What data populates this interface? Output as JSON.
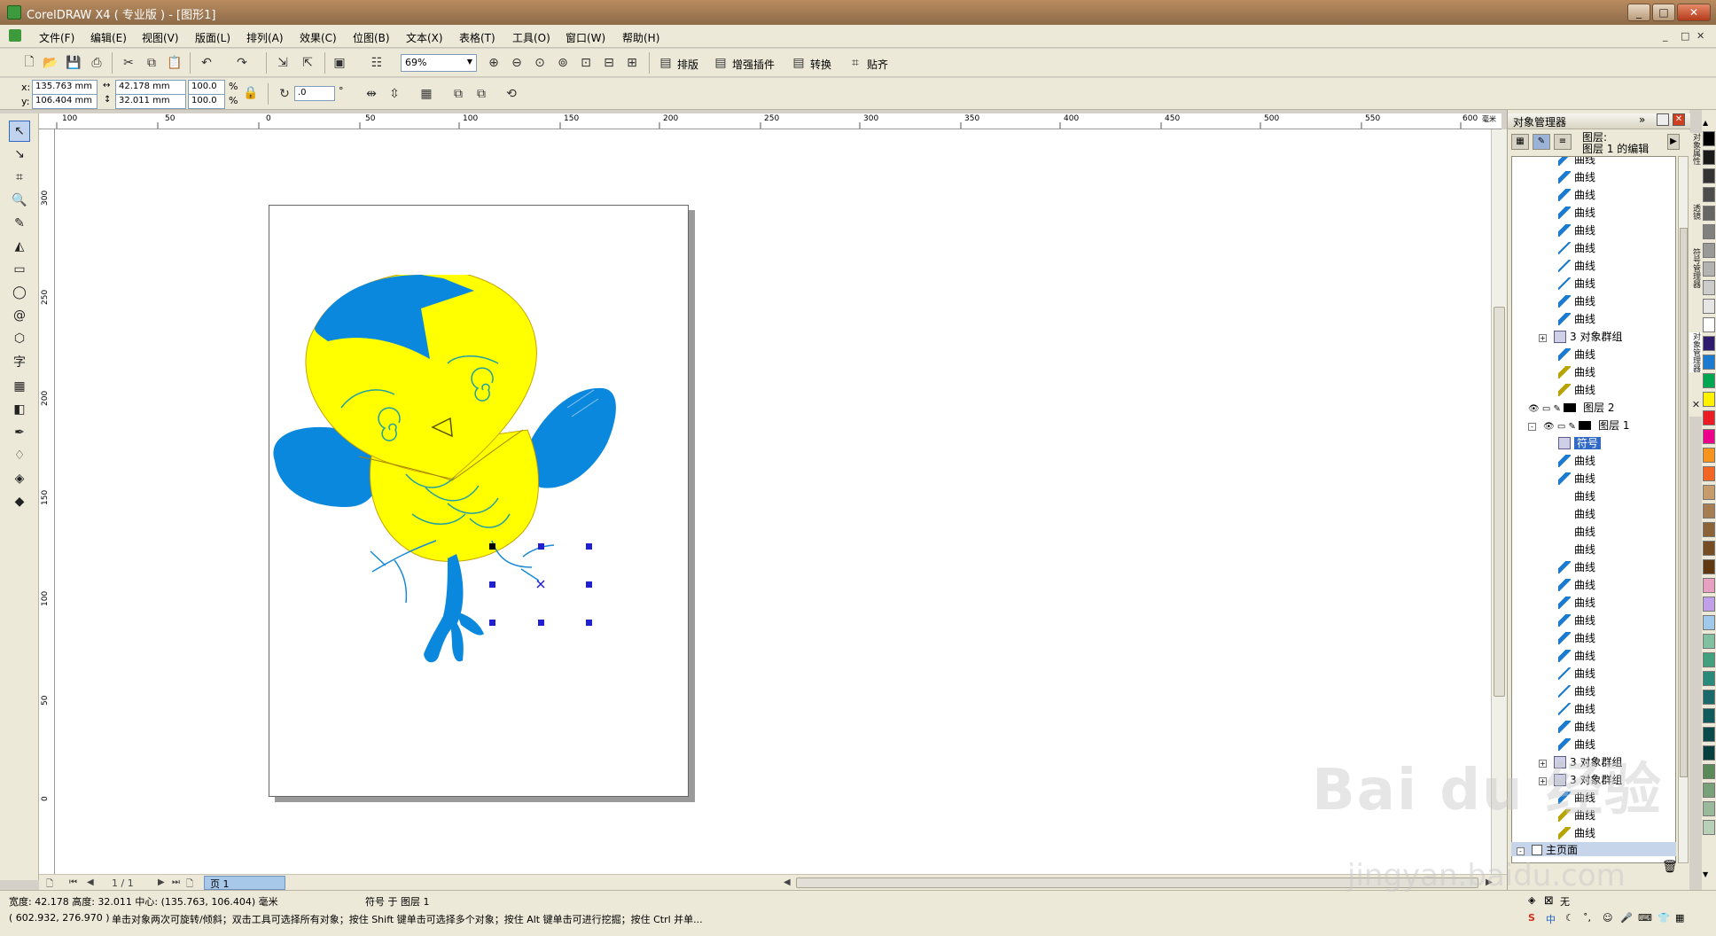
{
  "window": {
    "title": "CorelDRAW X4 ( 专业版 ) - [图形1]",
    "min": "_",
    "max": "□",
    "close": "✕"
  },
  "menu": {
    "items": [
      "文件(F)",
      "编辑(E)",
      "视图(V)",
      "版面(L)",
      "排列(A)",
      "效果(C)",
      "位图(B)",
      "文本(X)",
      "表格(T)",
      "工具(O)",
      "窗口(W)",
      "帮助(H)"
    ],
    "mdi": [
      "_",
      "□",
      "✕"
    ]
  },
  "toolbar": {
    "zoom": "69%",
    "buttons": [
      "排版",
      "增强插件",
      "转换",
      "贴齐"
    ]
  },
  "property_bar": {
    "x_label": "x:",
    "x": "135.763 mm",
    "y_label": "y:",
    "y": "106.404 mm",
    "width": "42.178 mm",
    "height": "32.011 mm",
    "scale_x": "100.0",
    "scale_y": "100.0",
    "percent": "%",
    "rotation": ".0",
    "degree": "°"
  },
  "rulers": {
    "h_ticks": [
      "100",
      "50",
      "0",
      "50",
      "100",
      "150",
      "200",
      "250",
      "300",
      "350",
      "400",
      "450",
      "500",
      "550",
      "600"
    ],
    "h_unit": "毫米",
    "v_ticks": [
      "300",
      "250",
      "200",
      "150",
      "100",
      "50",
      "0"
    ]
  },
  "toolbox": {
    "icons": [
      "pick-tool-icon",
      "shape-tool-icon",
      "crop-tool-icon",
      "zoom-tool-icon",
      "freehand-tool-icon",
      "smart-fill-icon",
      "rectangle-tool-icon",
      "ellipse-tool-icon",
      "spiral-tool-icon",
      "basic-shapes-icon",
      "text-tool-icon",
      "table-tool-icon",
      "interactive-blend-icon",
      "eyedropper-icon",
      "outline-tool-icon",
      "fill-tool-icon",
      "interactive-fill-icon"
    ],
    "text_tool_glyph": "字"
  },
  "page_nav": {
    "counter": "1 / 1",
    "tab": "页 1"
  },
  "docker": {
    "title": "对象管理器",
    "layer_header_line1": "图层:",
    "layer_header_line2": "图层 1",
    "layer_header_suffix": "的编辑",
    "rows": [
      {
        "label": "曲线",
        "icon": "curve-blue",
        "indent": 2
      },
      {
        "label": "曲线",
        "icon": "curve-blue",
        "indent": 2
      },
      {
        "label": "曲线",
        "icon": "curve-blue",
        "indent": 2
      },
      {
        "label": "曲线",
        "icon": "curve-blue",
        "indent": 2
      },
      {
        "label": "曲线",
        "icon": "curve-blue",
        "indent": 2
      },
      {
        "label": "曲线",
        "icon": "curve-thin",
        "indent": 2
      },
      {
        "label": "曲线",
        "icon": "curve-thin",
        "indent": 2
      },
      {
        "label": "曲线",
        "icon": "curve-thin",
        "indent": 2
      },
      {
        "label": "曲线",
        "icon": "curve-blue",
        "indent": 2
      },
      {
        "label": "曲线",
        "icon": "curve-blue",
        "indent": 2
      },
      {
        "label": "3 对象群组",
        "icon": "group",
        "indent": 1,
        "expand": "+"
      },
      {
        "label": "曲线",
        "icon": "curve-blue",
        "indent": 2
      },
      {
        "label": "曲线",
        "icon": "curve-gold",
        "indent": 2
      },
      {
        "label": "曲线",
        "icon": "curve-gold",
        "indent": 2
      },
      {
        "label": "图层 2",
        "icon": "layer",
        "indent": 0
      },
      {
        "label": "图层 1",
        "icon": "layer",
        "indent": 0,
        "expand": "-"
      },
      {
        "label": "符号",
        "icon": "symbol",
        "indent": 2,
        "selected": true
      },
      {
        "label": "曲线",
        "icon": "curve-blue",
        "indent": 2
      },
      {
        "label": "曲线",
        "icon": "curve-blue",
        "indent": 2
      },
      {
        "label": "曲线",
        "icon": "curve-none",
        "indent": 2
      },
      {
        "label": "曲线",
        "icon": "curve-none",
        "indent": 2
      },
      {
        "label": "曲线",
        "icon": "curve-none",
        "indent": 2
      },
      {
        "label": "曲线",
        "icon": "curve-none",
        "indent": 2
      },
      {
        "label": "曲线",
        "icon": "curve-blue",
        "indent": 2
      },
      {
        "label": "曲线",
        "icon": "curve-blue",
        "indent": 2
      },
      {
        "label": "曲线",
        "icon": "curve-blue",
        "indent": 2
      },
      {
        "label": "曲线",
        "icon": "curve-blue",
        "indent": 2
      },
      {
        "label": "曲线",
        "icon": "curve-blue",
        "indent": 2
      },
      {
        "label": "曲线",
        "icon": "curve-blue",
        "indent": 2
      },
      {
        "label": "曲线",
        "icon": "curve-thin",
        "indent": 2
      },
      {
        "label": "曲线",
        "icon": "curve-thin",
        "indent": 2
      },
      {
        "label": "曲线",
        "icon": "curve-thin",
        "indent": 2
      },
      {
        "label": "曲线",
        "icon": "curve-blue",
        "indent": 2
      },
      {
        "label": "曲线",
        "icon": "curve-blue",
        "indent": 2
      },
      {
        "label": "3 对象群组",
        "icon": "group",
        "indent": 1,
        "expand": "+"
      },
      {
        "label": "3 对象群组",
        "icon": "group",
        "indent": 1,
        "expand": "+"
      },
      {
        "label": "曲线",
        "icon": "curve-blue",
        "indent": 2
      },
      {
        "label": "曲线",
        "icon": "curve-gold",
        "indent": 2
      },
      {
        "label": "曲线",
        "icon": "curve-gold",
        "indent": 2
      }
    ],
    "master_page": "主页面",
    "side_tabs": [
      "对象属性",
      "透镜",
      "符号管理器",
      "对象管理器"
    ]
  },
  "palette": {
    "colors": [
      "#000000",
      "#1a1a1a",
      "#333333",
      "#4d4d4d",
      "#666666",
      "#808080",
      "#999999",
      "#b3b3b3",
      "#cccccc",
      "#e6e6e6",
      "#ffffff",
      "#2e1a6e",
      "#1a7bd0",
      "#00a651",
      "#fff200",
      "#ed1c24",
      "#ec008c",
      "#f7941d",
      "#f26522",
      "#c69c6d",
      "#a67c52",
      "#8c6239",
      "#754c24",
      "#603913",
      "#e8a0c0",
      "#c0a0e8",
      "#a0c8e8",
      "#80c0a0",
      "#40a080",
      "#2a8a7a",
      "#1a6a6a",
      "#0f5a5a",
      "#0a4a4a",
      "#084040",
      "#5a8a5a",
      "#7aa07a",
      "#9ab89a",
      "#b8d0b8"
    ],
    "no_color_label": "无"
  },
  "status": {
    "dims": "宽度: 42.178  高度: 32.011  中心: (135.763, 106.404)  毫米",
    "object_info": "符号 于 图层 1",
    "cursor": "( 602.932, 276.970 )",
    "hint": "单击对象两次可旋转/倾斜；双击工具可选择所有对象；按住 Shift 键单击可选择多个对象；按住 Alt 键单击可进行挖掘；按住 Ctrl 并单...",
    "fill_label": "无"
  },
  "colors": {
    "owl_yellow": "#ffff00",
    "owl_blue": "#0a88de",
    "selection_handle": "#2020d0"
  },
  "watermark": {
    "text": "Bai du 经验",
    "url": "jingyan.baidu.com"
  }
}
